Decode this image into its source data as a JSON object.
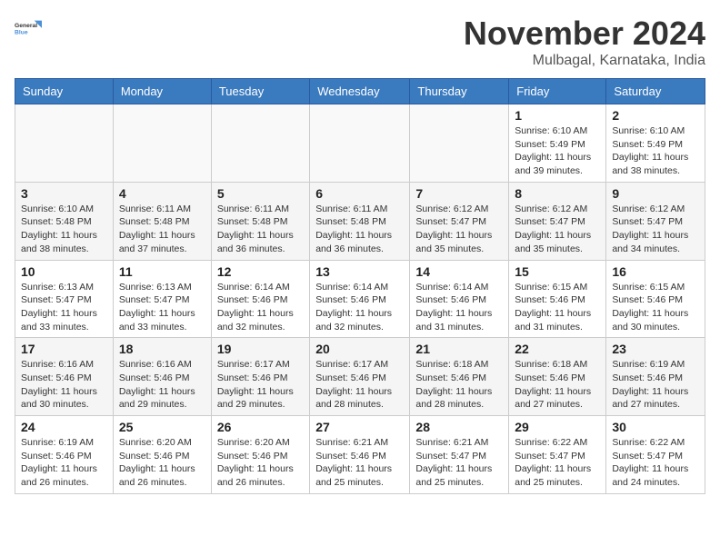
{
  "logo": {
    "line1": "General",
    "line2": "Blue"
  },
  "title": "November 2024",
  "location": "Mulbagal, Karnataka, India",
  "days_header": [
    "Sunday",
    "Monday",
    "Tuesday",
    "Wednesday",
    "Thursday",
    "Friday",
    "Saturday"
  ],
  "weeks": [
    [
      {
        "day": "",
        "info": ""
      },
      {
        "day": "",
        "info": ""
      },
      {
        "day": "",
        "info": ""
      },
      {
        "day": "",
        "info": ""
      },
      {
        "day": "",
        "info": ""
      },
      {
        "day": "1",
        "info": "Sunrise: 6:10 AM\nSunset: 5:49 PM\nDaylight: 11 hours and 39 minutes."
      },
      {
        "day": "2",
        "info": "Sunrise: 6:10 AM\nSunset: 5:49 PM\nDaylight: 11 hours and 38 minutes."
      }
    ],
    [
      {
        "day": "3",
        "info": "Sunrise: 6:10 AM\nSunset: 5:48 PM\nDaylight: 11 hours and 38 minutes."
      },
      {
        "day": "4",
        "info": "Sunrise: 6:11 AM\nSunset: 5:48 PM\nDaylight: 11 hours and 37 minutes."
      },
      {
        "day": "5",
        "info": "Sunrise: 6:11 AM\nSunset: 5:48 PM\nDaylight: 11 hours and 36 minutes."
      },
      {
        "day": "6",
        "info": "Sunrise: 6:11 AM\nSunset: 5:48 PM\nDaylight: 11 hours and 36 minutes."
      },
      {
        "day": "7",
        "info": "Sunrise: 6:12 AM\nSunset: 5:47 PM\nDaylight: 11 hours and 35 minutes."
      },
      {
        "day": "8",
        "info": "Sunrise: 6:12 AM\nSunset: 5:47 PM\nDaylight: 11 hours and 35 minutes."
      },
      {
        "day": "9",
        "info": "Sunrise: 6:12 AM\nSunset: 5:47 PM\nDaylight: 11 hours and 34 minutes."
      }
    ],
    [
      {
        "day": "10",
        "info": "Sunrise: 6:13 AM\nSunset: 5:47 PM\nDaylight: 11 hours and 33 minutes."
      },
      {
        "day": "11",
        "info": "Sunrise: 6:13 AM\nSunset: 5:47 PM\nDaylight: 11 hours and 33 minutes."
      },
      {
        "day": "12",
        "info": "Sunrise: 6:14 AM\nSunset: 5:46 PM\nDaylight: 11 hours and 32 minutes."
      },
      {
        "day": "13",
        "info": "Sunrise: 6:14 AM\nSunset: 5:46 PM\nDaylight: 11 hours and 32 minutes."
      },
      {
        "day": "14",
        "info": "Sunrise: 6:14 AM\nSunset: 5:46 PM\nDaylight: 11 hours and 31 minutes."
      },
      {
        "day": "15",
        "info": "Sunrise: 6:15 AM\nSunset: 5:46 PM\nDaylight: 11 hours and 31 minutes."
      },
      {
        "day": "16",
        "info": "Sunrise: 6:15 AM\nSunset: 5:46 PM\nDaylight: 11 hours and 30 minutes."
      }
    ],
    [
      {
        "day": "17",
        "info": "Sunrise: 6:16 AM\nSunset: 5:46 PM\nDaylight: 11 hours and 30 minutes."
      },
      {
        "day": "18",
        "info": "Sunrise: 6:16 AM\nSunset: 5:46 PM\nDaylight: 11 hours and 29 minutes."
      },
      {
        "day": "19",
        "info": "Sunrise: 6:17 AM\nSunset: 5:46 PM\nDaylight: 11 hours and 29 minutes."
      },
      {
        "day": "20",
        "info": "Sunrise: 6:17 AM\nSunset: 5:46 PM\nDaylight: 11 hours and 28 minutes."
      },
      {
        "day": "21",
        "info": "Sunrise: 6:18 AM\nSunset: 5:46 PM\nDaylight: 11 hours and 28 minutes."
      },
      {
        "day": "22",
        "info": "Sunrise: 6:18 AM\nSunset: 5:46 PM\nDaylight: 11 hours and 27 minutes."
      },
      {
        "day": "23",
        "info": "Sunrise: 6:19 AM\nSunset: 5:46 PM\nDaylight: 11 hours and 27 minutes."
      }
    ],
    [
      {
        "day": "24",
        "info": "Sunrise: 6:19 AM\nSunset: 5:46 PM\nDaylight: 11 hours and 26 minutes."
      },
      {
        "day": "25",
        "info": "Sunrise: 6:20 AM\nSunset: 5:46 PM\nDaylight: 11 hours and 26 minutes."
      },
      {
        "day": "26",
        "info": "Sunrise: 6:20 AM\nSunset: 5:46 PM\nDaylight: 11 hours and 26 minutes."
      },
      {
        "day": "27",
        "info": "Sunrise: 6:21 AM\nSunset: 5:46 PM\nDaylight: 11 hours and 25 minutes."
      },
      {
        "day": "28",
        "info": "Sunrise: 6:21 AM\nSunset: 5:47 PM\nDaylight: 11 hours and 25 minutes."
      },
      {
        "day": "29",
        "info": "Sunrise: 6:22 AM\nSunset: 5:47 PM\nDaylight: 11 hours and 25 minutes."
      },
      {
        "day": "30",
        "info": "Sunrise: 6:22 AM\nSunset: 5:47 PM\nDaylight: 11 hours and 24 minutes."
      }
    ]
  ]
}
